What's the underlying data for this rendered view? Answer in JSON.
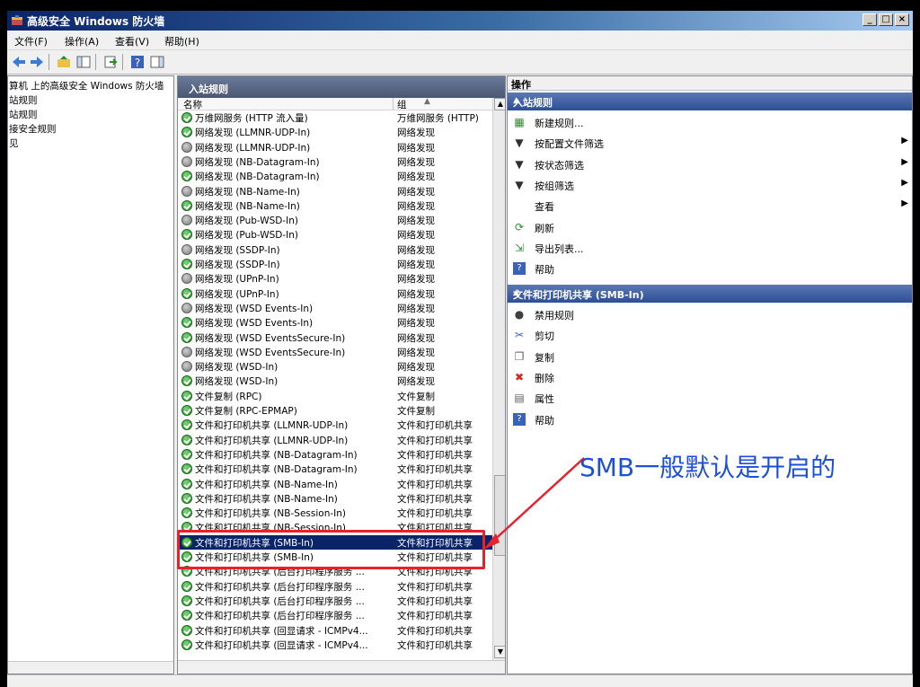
{
  "window": {
    "title": "高级安全 Windows 防火墙",
    "min": "_",
    "max": "□",
    "close": "×"
  },
  "menu": [
    "文件(F)",
    "操作(A)",
    "查看(V)",
    "帮助(H)"
  ],
  "toolbar": {
    "icons": [
      "back-arrow-icon",
      "forward-arrow-icon",
      "up-folder-icon",
      "show-hide-tree-icon",
      "export-icon",
      "help-icon",
      "show-hide-action-icon"
    ]
  },
  "tree": {
    "items": [
      "算机 上的高级安全 Windows 防火墙",
      "站规则",
      "站规则",
      "接安全规则",
      "见"
    ]
  },
  "middle": {
    "header": "入站规则",
    "col_name": "名称",
    "col_group": "组",
    "rows": [
      {
        "name": "万维网服务 (HTTP 流入量)",
        "group": "万维网服务 (HTTP)",
        "on": true
      },
      {
        "name": "网络发现 (LLMNR-UDP-In)",
        "group": "网络发现",
        "on": true
      },
      {
        "name": "网络发现 (LLMNR-UDP-In)",
        "group": "网络发现",
        "on": false
      },
      {
        "name": "网络发现 (NB-Datagram-In)",
        "group": "网络发现",
        "on": false
      },
      {
        "name": "网络发现 (NB-Datagram-In)",
        "group": "网络发现",
        "on": true
      },
      {
        "name": "网络发现 (NB-Name-In)",
        "group": "网络发现",
        "on": false
      },
      {
        "name": "网络发现 (NB-Name-In)",
        "group": "网络发现",
        "on": true
      },
      {
        "name": "网络发现 (Pub-WSD-In)",
        "group": "网络发现",
        "on": false
      },
      {
        "name": "网络发现 (Pub-WSD-In)",
        "group": "网络发现",
        "on": true
      },
      {
        "name": "网络发现 (SSDP-In)",
        "group": "网络发现",
        "on": false
      },
      {
        "name": "网络发现 (SSDP-In)",
        "group": "网络发现",
        "on": true
      },
      {
        "name": "网络发现 (UPnP-In)",
        "group": "网络发现",
        "on": false
      },
      {
        "name": "网络发现 (UPnP-In)",
        "group": "网络发现",
        "on": true
      },
      {
        "name": "网络发现 (WSD Events-In)",
        "group": "网络发现",
        "on": false
      },
      {
        "name": "网络发现 (WSD Events-In)",
        "group": "网络发现",
        "on": true
      },
      {
        "name": "网络发现 (WSD EventsSecure-In)",
        "group": "网络发现",
        "on": true
      },
      {
        "name": "网络发现 (WSD EventsSecure-In)",
        "group": "网络发现",
        "on": false
      },
      {
        "name": "网络发现 (WSD-In)",
        "group": "网络发现",
        "on": false
      },
      {
        "name": "网络发现 (WSD-In)",
        "group": "网络发现",
        "on": true
      },
      {
        "name": "文件复制 (RPC)",
        "group": "文件复制",
        "on": true
      },
      {
        "name": "文件复制 (RPC-EPMAP)",
        "group": "文件复制",
        "on": true
      },
      {
        "name": "文件和打印机共享 (LLMNR-UDP-In)",
        "group": "文件和打印机共享",
        "on": true
      },
      {
        "name": "文件和打印机共享 (LLMNR-UDP-In)",
        "group": "文件和打印机共享",
        "on": true
      },
      {
        "name": "文件和打印机共享 (NB-Datagram-In)",
        "group": "文件和打印机共享",
        "on": true
      },
      {
        "name": "文件和打印机共享 (NB-Datagram-In)",
        "group": "文件和打印机共享",
        "on": true
      },
      {
        "name": "文件和打印机共享 (NB-Name-In)",
        "group": "文件和打印机共享",
        "on": true
      },
      {
        "name": "文件和打印机共享 (NB-Name-In)",
        "group": "文件和打印机共享",
        "on": true
      },
      {
        "name": "文件和打印机共享 (NB-Session-In)",
        "group": "文件和打印机共享",
        "on": true
      },
      {
        "name": "文件和打印机共享 (NB-Session-In)",
        "group": "文件和打印机共享",
        "on": true
      },
      {
        "name": "文件和打印机共享 (SMB-In)",
        "group": "文件和打印机共享",
        "on": true,
        "selected": true
      },
      {
        "name": "文件和打印机共享 (SMB-In)",
        "group": "文件和打印机共享",
        "on": true
      },
      {
        "name": "文件和打印机共享 (后台打印程序服务 ...",
        "group": "文件和打印机共享",
        "on": true
      },
      {
        "name": "文件和打印机共享 (后台打印程序服务 ...",
        "group": "文件和打印机共享",
        "on": true
      },
      {
        "name": "文件和打印机共享 (后台打印程序服务 ...",
        "group": "文件和打印机共享",
        "on": true
      },
      {
        "name": "文件和打印机共享 (后台打印程序服务 ...",
        "group": "文件和打印机共享",
        "on": true
      },
      {
        "name": "文件和打印机共享 (回显请求 - ICMPv4...",
        "group": "文件和打印机共享",
        "on": true
      },
      {
        "name": "文件和打印机共享 (回显请求 - ICMPv4...",
        "group": "文件和打印机共享",
        "on": true
      }
    ]
  },
  "actions": {
    "header": "操作",
    "section1": {
      "title": "入站规则",
      "items": [
        {
          "label": "新建规则...",
          "icon": "new-rule-icon",
          "arrow": false
        },
        {
          "label": "按配置文件筛选",
          "icon": "filter-icon",
          "arrow": true
        },
        {
          "label": "按状态筛选",
          "icon": "filter-icon",
          "arrow": true
        },
        {
          "label": "按组筛选",
          "icon": "filter-icon",
          "arrow": true
        },
        {
          "label": "查看",
          "icon": "",
          "arrow": true
        },
        {
          "label": "刷新",
          "icon": "refresh-icon",
          "arrow": false
        },
        {
          "label": "导出列表...",
          "icon": "export-list-icon",
          "arrow": false
        },
        {
          "label": "帮助",
          "icon": "help-icon",
          "arrow": false
        }
      ]
    },
    "section2": {
      "title": "文件和打印机共享 (SMB-In)",
      "items": [
        {
          "label": "禁用规则",
          "icon": "disable-rule-icon"
        },
        {
          "label": "剪切",
          "icon": "cut-icon"
        },
        {
          "label": "复制",
          "icon": "copy-icon"
        },
        {
          "label": "删除",
          "icon": "delete-icon"
        },
        {
          "label": "属性",
          "icon": "properties-icon"
        },
        {
          "label": "帮助",
          "icon": "help-icon"
        }
      ]
    }
  },
  "annotation": {
    "text": "SMB一般默认是开启的",
    "color": "#1d4fd8",
    "box_color": "#e8212a"
  }
}
